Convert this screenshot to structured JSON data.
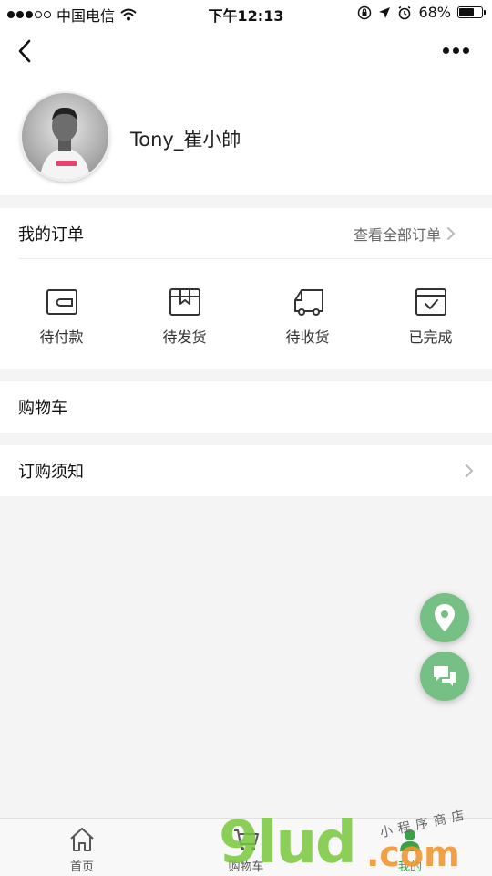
{
  "status_bar": {
    "carrier": "中国电信",
    "time": "下午12:13",
    "battery": "68%",
    "battery_level": 0.68
  },
  "nav": {
    "back_icon": "chevron-left-icon",
    "more_icon": "more-dots-icon"
  },
  "profile": {
    "username": "Tony_崔小帥"
  },
  "orders": {
    "title": "我的订单",
    "view_all": "查看全部订单",
    "items": [
      {
        "label": "待付款",
        "icon": "wallet-icon"
      },
      {
        "label": "待发货",
        "icon": "package-icon"
      },
      {
        "label": "待收货",
        "icon": "truck-icon"
      },
      {
        "label": "已完成",
        "icon": "completed-box-icon"
      }
    ]
  },
  "rows": {
    "cart": "购物车",
    "notice": "订购须知"
  },
  "fab": {
    "location_icon": "location-pin-icon",
    "chat_icon": "chat-bubbles-icon",
    "color": "#76c085"
  },
  "tabs": [
    {
      "label": "首页",
      "icon": "home-icon"
    },
    {
      "label": "购物车",
      "icon": "cart-icon"
    },
    {
      "label": "我的",
      "icon": "user-icon"
    }
  ],
  "watermark": {
    "main": "9lud",
    "suffix": ".com",
    "tagline": "小程序商店"
  }
}
